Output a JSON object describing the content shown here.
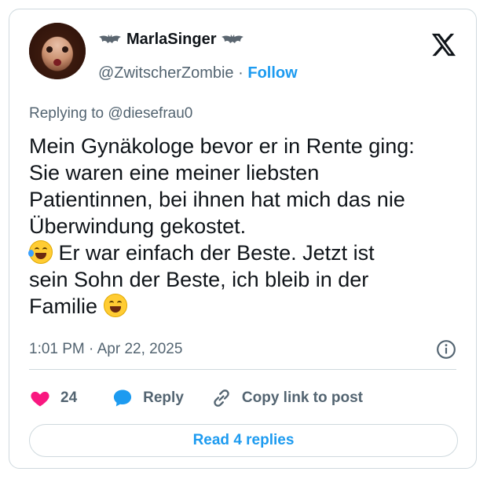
{
  "author": {
    "display_name": "MarlaSinger",
    "handle": "@ZwitscherZombie",
    "separator": "·",
    "follow_label": "Follow",
    "name_decoration_icon": "bat-icon",
    "avatar_icon": "avatar-photo"
  },
  "brand_icon": "x-logo-icon",
  "reply_context": {
    "prefix": "Replying to",
    "mention": "@diesefrau0"
  },
  "post": {
    "lines": [
      "Mein Gynäkologe bevor er in Rente ging:",
      "Sie waren eine meiner liebsten",
      "Patientinnen, bei ihnen hat mich das nie",
      "Überwindung gekostet.",
      "Er war einfach der Beste. Jetzt ist",
      "sein Sohn der Beste, ich bleib in der",
      "Familie"
    ],
    "emojis": [
      "rolling-on-floor-laughing-emoji",
      "grinning-squinting-face-emoji"
    ]
  },
  "meta": {
    "time": "1:01 PM",
    "separator": "·",
    "date": "Apr 22, 2025",
    "info_icon": "info-icon"
  },
  "actions": {
    "like_count": "24",
    "reply_label": "Reply",
    "copy_link_label": "Copy link to post"
  },
  "read_replies_label": "Read 4 replies",
  "colors": {
    "accent": "#1d9bf0",
    "heart": "#f91880",
    "text_primary": "#0f1419",
    "text_secondary": "#536471",
    "border": "#cfd9de"
  }
}
